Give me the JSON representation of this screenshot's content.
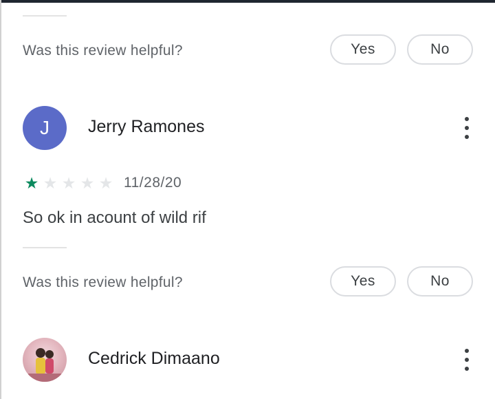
{
  "reviews": [
    {
      "helpful_prompt": "Was this review helpful?",
      "yes_label": "Yes",
      "no_label": "No"
    },
    {
      "reviewer_name": "Jerry Ramones",
      "avatar_initial": "J",
      "avatar_color": "#5b6bc8",
      "rating": 1,
      "max_rating": 5,
      "date": "11/28/20",
      "text": "So ok in acount of wild rif",
      "helpful_prompt": "Was this review helpful?",
      "yes_label": "Yes",
      "no_label": "No"
    },
    {
      "reviewer_name": "Cedrick Dimaano",
      "avatar_type": "photo"
    }
  ],
  "icons": {
    "more": "more-vert-icon",
    "star_filled": "star-filled-icon",
    "star_empty": "star-empty-icon"
  },
  "colors": {
    "star_filled": "#0b8a5e",
    "star_empty": "#e4e6e8"
  }
}
